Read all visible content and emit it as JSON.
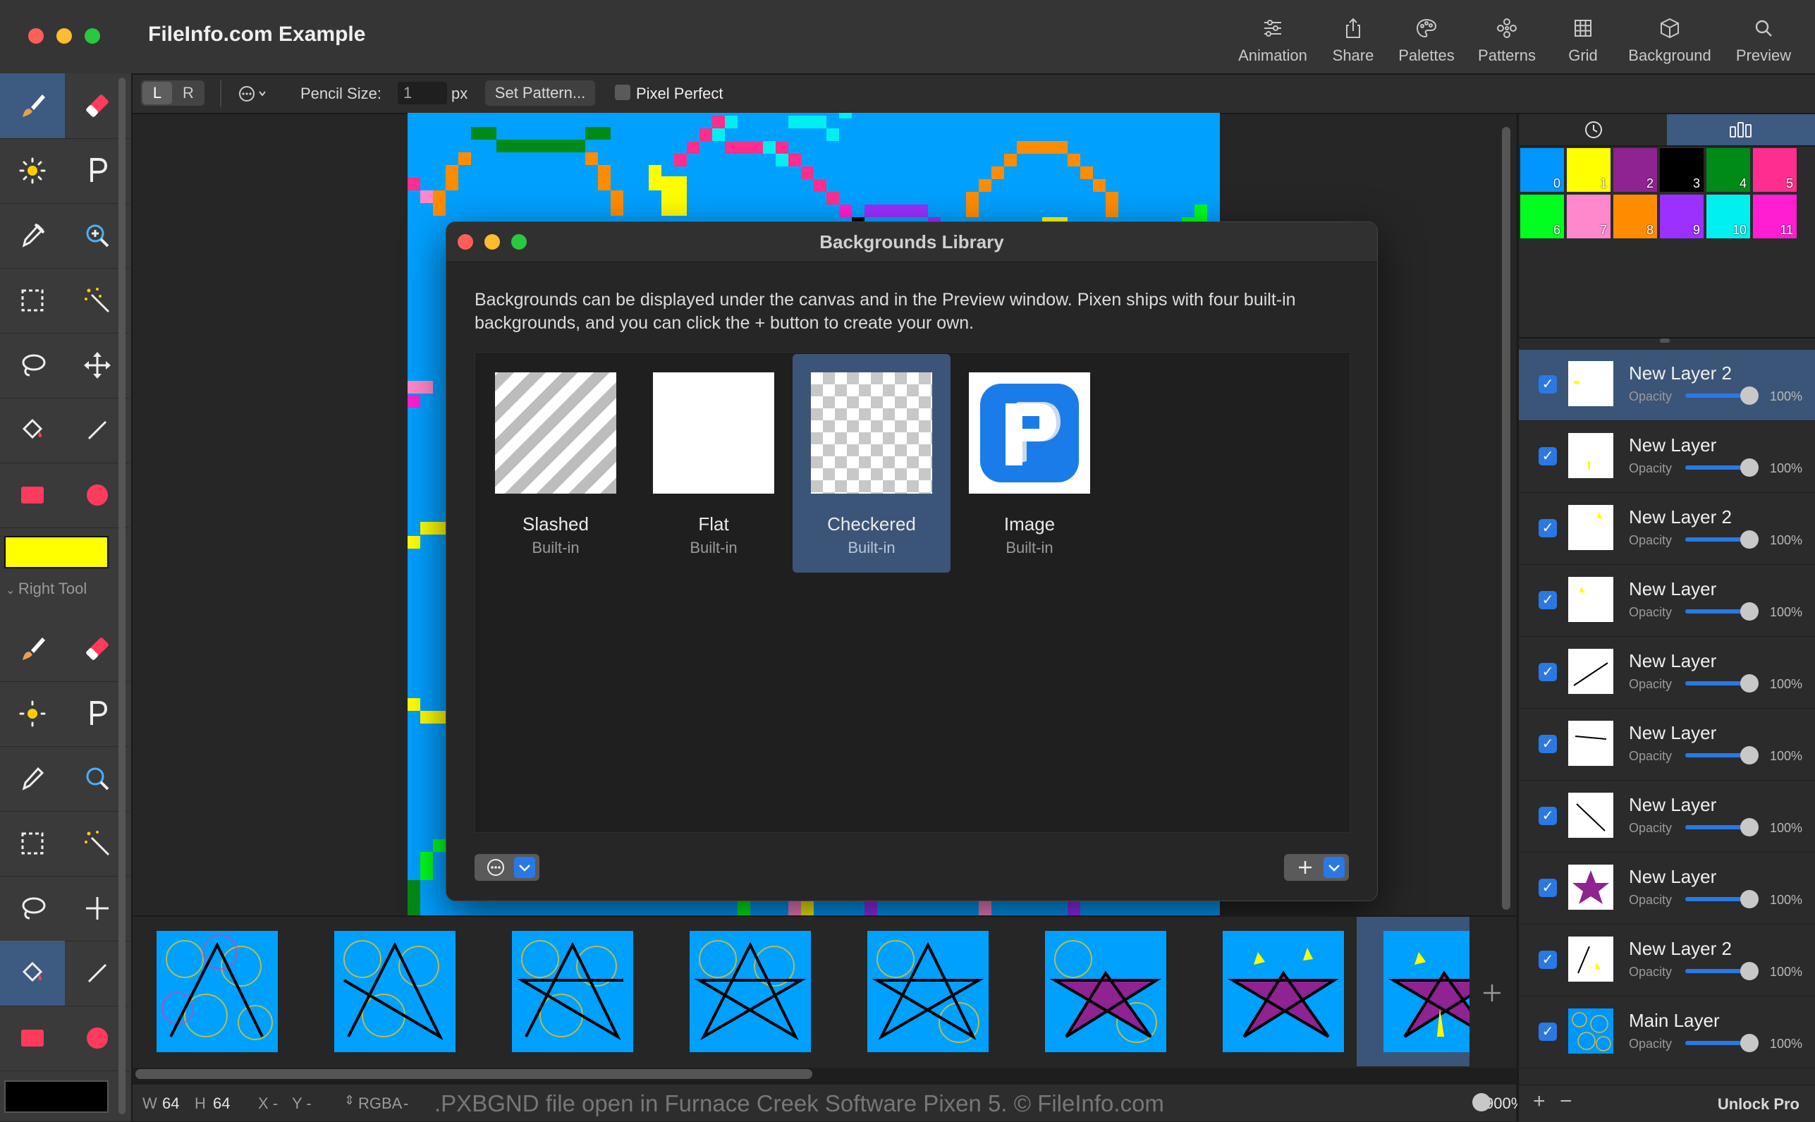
{
  "window": {
    "title": "FileInfo.com Example"
  },
  "toolbar_buttons": [
    {
      "label": "Animation",
      "icon": "sliders-icon"
    },
    {
      "label": "Share",
      "icon": "share-icon"
    },
    {
      "label": "Palettes",
      "icon": "palette-icon"
    },
    {
      "label": "Patterns",
      "icon": "patterns-icon"
    },
    {
      "label": "Grid",
      "icon": "grid-icon"
    },
    {
      "label": "Background",
      "icon": "cube-icon"
    },
    {
      "label": "Preview",
      "icon": "magnifier-icon"
    }
  ],
  "options": {
    "left": "L",
    "right": "R",
    "pencil_size_label": "Pencil Size:",
    "pencil_size_value": "1",
    "pencil_size_unit": "px",
    "set_pattern": "Set Pattern...",
    "pixel_perfect": "Pixel Perfect"
  },
  "tools": {
    "right_tool_label": "Right Tool",
    "left_color": "#ffff00",
    "right_color": "#000000"
  },
  "dialog": {
    "title": "Backgrounds Library",
    "description": "Backgrounds can be displayed under the canvas and in the Preview window. Pixen ships with four built-in backgrounds, and you can click the + button to create your own.",
    "items": [
      {
        "name": "Slashed",
        "sub": "Built-in"
      },
      {
        "name": "Flat",
        "sub": "Built-in"
      },
      {
        "name": "Checkered",
        "sub": "Built-in"
      },
      {
        "name": "Image",
        "sub": "Built-in"
      }
    ],
    "selected": "Checkered"
  },
  "palette": [
    {
      "n": "0",
      "c": "#0096ff"
    },
    {
      "n": "1",
      "c": "#ffff00"
    },
    {
      "n": "2",
      "c": "#8e2391"
    },
    {
      "n": "3",
      "c": "#000000"
    },
    {
      "n": "4",
      "c": "#008a17"
    },
    {
      "n": "5",
      "c": "#ff2e8e"
    },
    {
      "n": "6",
      "c": "#00ff1e"
    },
    {
      "n": "7",
      "c": "#ff88cc"
    },
    {
      "n": "8",
      "c": "#ff8c00"
    },
    {
      "n": "9",
      "c": "#9b30ff"
    },
    {
      "n": "10",
      "c": "#00f0f0"
    },
    {
      "n": "11",
      "c": "#ff1ed2"
    }
  ],
  "layers": [
    {
      "name": "New Layer 2",
      "opacity_label": "Opacity",
      "opacity": "100%"
    },
    {
      "name": "New Layer",
      "opacity_label": "Opacity",
      "opacity": "100%"
    },
    {
      "name": "New Layer 2",
      "opacity_label": "Opacity",
      "opacity": "100%"
    },
    {
      "name": "New Layer",
      "opacity_label": "Opacity",
      "opacity": "100%"
    },
    {
      "name": "New Layer",
      "opacity_label": "Opacity",
      "opacity": "100%"
    },
    {
      "name": "New Layer",
      "opacity_label": "Opacity",
      "opacity": "100%"
    },
    {
      "name": "New Layer",
      "opacity_label": "Opacity",
      "opacity": "100%"
    },
    {
      "name": "New Layer",
      "opacity_label": "Opacity",
      "opacity": "100%"
    },
    {
      "name": "New Layer 2",
      "opacity_label": "Opacity",
      "opacity": "100%"
    },
    {
      "name": "Main Layer",
      "opacity_label": "Opacity",
      "opacity": "100%"
    }
  ],
  "status": {
    "w_label": "W",
    "w": "64",
    "h_label": "H",
    "h": "64",
    "x": "X -",
    "y": "Y -",
    "mode": "RGBA",
    "mode_value": "-",
    "caption": ".PXBGND file open in Furnace Creek Software Pixen 5. © FileInfo.com",
    "zoom": "900%",
    "unlock": "Unlock Pro"
  },
  "colors": {
    "accent": "#2a78e4",
    "selection": "#3b5578"
  }
}
